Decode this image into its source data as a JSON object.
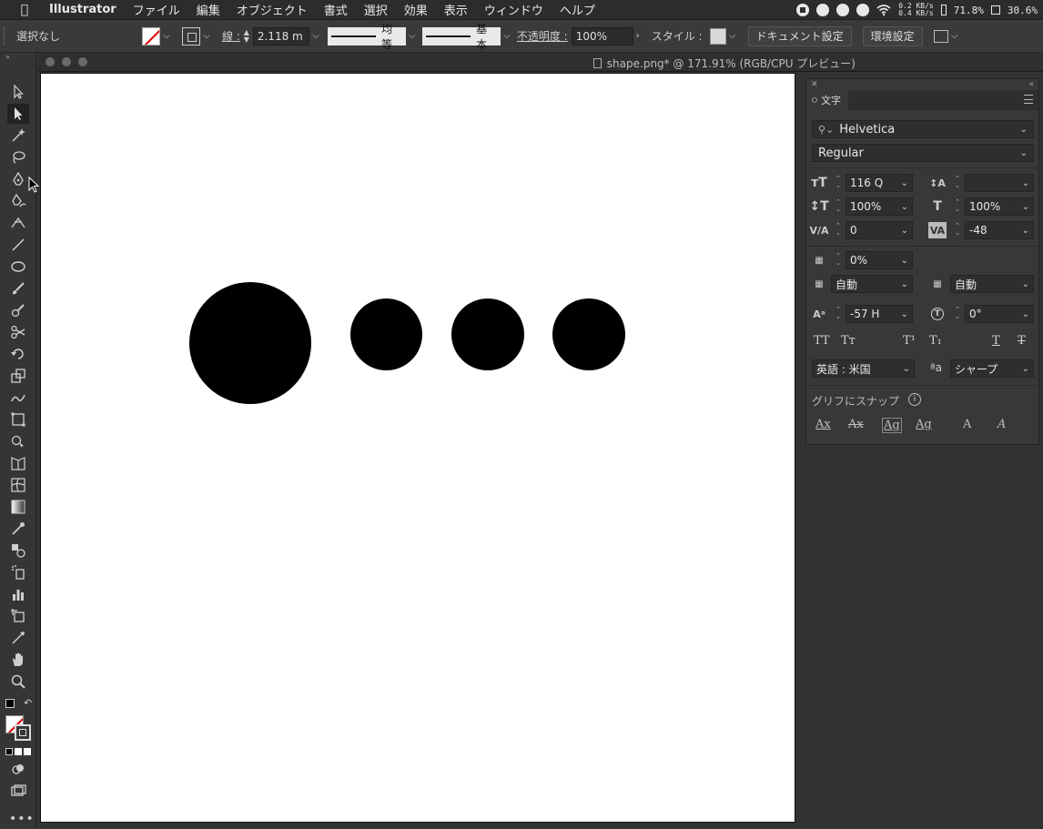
{
  "menubar": {
    "app_name": "Illustrator",
    "items": [
      "ファイル",
      "編集",
      "オブジェクト",
      "書式",
      "選択",
      "効果",
      "表示",
      "ウィンドウ",
      "ヘルプ"
    ],
    "status": {
      "net_up": "0.2 KB/s",
      "net_down": "0.4 KB/s",
      "memory": "71.8%",
      "cpu": "30.6%"
    }
  },
  "controlbar": {
    "selection_label": "選択なし",
    "stroke_label": "線 :",
    "stroke_weight": "2.118 m",
    "profile_uniform": "均等",
    "brush_basic": "基本",
    "opacity_label": "不透明度 :",
    "opacity_value": "100%",
    "style_label": "スタイル :",
    "document_setup": "ドキュメント設定",
    "preferences": "環境設定"
  },
  "document": {
    "title": "shape.png* @ 171.91% (RGB/CPU プレビュー)"
  },
  "character_panel": {
    "tab": "文字",
    "font_family": "Helvetica",
    "font_style": "Regular",
    "font_size": "116 Q",
    "leading": "",
    "vertical_scale": "100%",
    "horizontal_scale": "100%",
    "kerning": "0",
    "tracking": "-48",
    "tsume": "0%",
    "aki_left": "自動",
    "aki_right": "自動",
    "baseline_shift": "-57 H",
    "rotation": "0°",
    "language": "英語 : 米国",
    "antialias_label": "ªa",
    "antialias": "シャープ",
    "snap_label": "グリフにスナップ",
    "type_buttons": [
      "TT",
      "Tт",
      "T¹",
      "T₁",
      "T",
      "T"
    ],
    "snap_buttons": [
      "Ax",
      "Ax",
      "Ag",
      "Ag",
      "A",
      "A"
    ]
  },
  "colors": {
    "ui_bg": "#323232",
    "artboard": "#ffffff",
    "shape_fill": "#000000"
  }
}
